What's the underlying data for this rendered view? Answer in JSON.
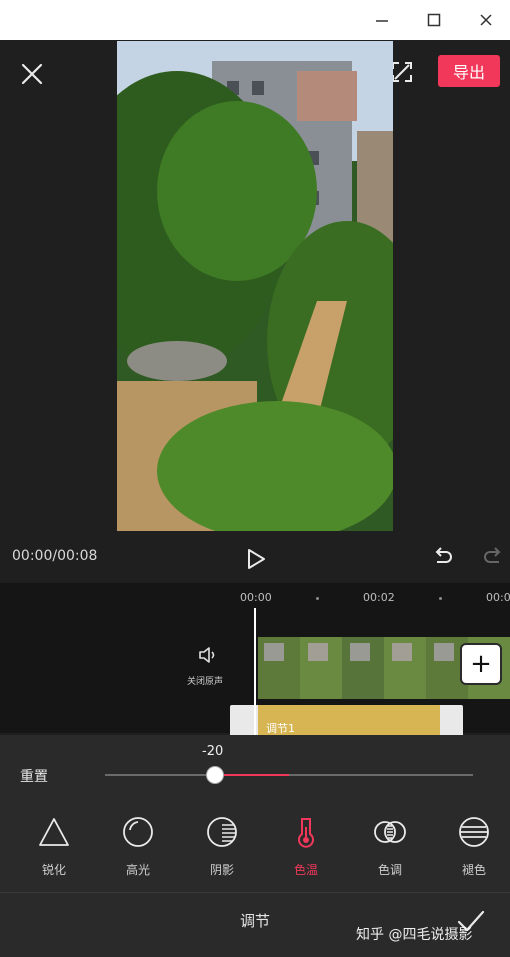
{
  "window": {
    "minimize_glyph": "—",
    "maximize_glyph": "☐",
    "close_glyph": "✕"
  },
  "header": {
    "export_label": "导出"
  },
  "player": {
    "time": "00:00/00:08"
  },
  "timeline": {
    "ruler": [
      "00:00",
      "00:02",
      "00:0"
    ],
    "mute_label": "关闭原声",
    "add_label": "+",
    "adjust_clip_label": "调节1"
  },
  "adjust": {
    "value": "-20",
    "reset_label": "重置",
    "slider_value": -20,
    "tools": [
      {
        "label": "锐化",
        "icon": "triangle-icon"
      },
      {
        "label": "高光",
        "icon": "highlight-icon"
      },
      {
        "label": "阴影",
        "icon": "shadow-icon"
      },
      {
        "label": "色温",
        "icon": "thermometer-icon",
        "active": true
      },
      {
        "label": "色调",
        "icon": "tone-icon"
      },
      {
        "label": "褪色",
        "icon": "fade-icon"
      }
    ],
    "tab_title": "调节"
  },
  "watermark": "知乎 @四毛说摄影",
  "colors": {
    "accent": "#f2385a",
    "background": "#1f1f1f",
    "panel": "#2a2a2a"
  }
}
